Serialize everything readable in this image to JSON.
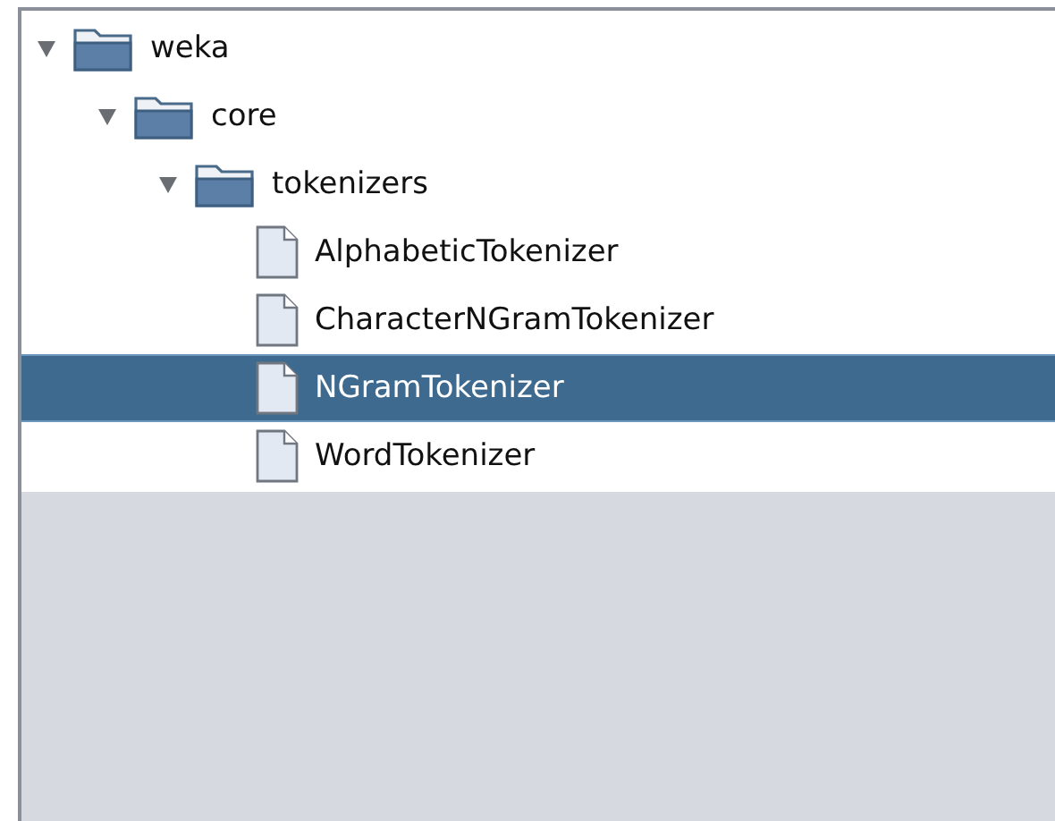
{
  "tree": [
    {
      "label": "weka",
      "kind": "folder",
      "expanded": true,
      "selected": false,
      "children": [
        {
          "label": "core",
          "kind": "folder",
          "expanded": true,
          "selected": false,
          "children": [
            {
              "label": "tokenizers",
              "kind": "folder",
              "expanded": true,
              "selected": false,
              "children": [
                {
                  "label": "AlphabeticTokenizer",
                  "kind": "file",
                  "selected": false
                },
                {
                  "label": "CharacterNGramTokenizer",
                  "kind": "file",
                  "selected": false
                },
                {
                  "label": "NGramTokenizer",
                  "kind": "file",
                  "selected": true
                },
                {
                  "label": "WordTokenizer",
                  "kind": "file",
                  "selected": false
                }
              ]
            }
          ]
        }
      ]
    }
  ]
}
